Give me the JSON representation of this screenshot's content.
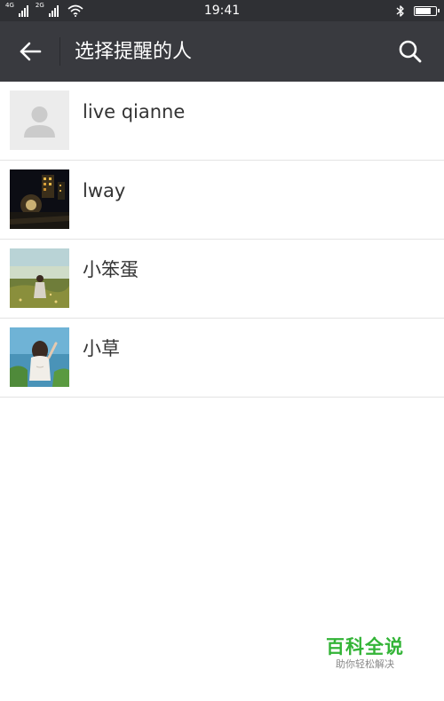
{
  "status_bar": {
    "network_1": "4G",
    "network_2": "2G",
    "time": "19:41",
    "battery_level": 0.8
  },
  "header": {
    "title": "选择提醒的人"
  },
  "contacts": [
    {
      "name": "live qianne",
      "avatar": "default-avatar-icon"
    },
    {
      "name": "lway",
      "avatar": "night-city-photo"
    },
    {
      "name": "小笨蛋",
      "avatar": "meadow-girl-photo"
    },
    {
      "name": "小草",
      "avatar": "seaside-girl-photo"
    }
  ],
  "watermark": {
    "title": "百科全说",
    "subtitle": "助你轻松解决"
  },
  "colors": {
    "status_bar_bg": "#2f3034",
    "toolbar_bg": "#393a3f",
    "watermark_green": "#33b437"
  }
}
